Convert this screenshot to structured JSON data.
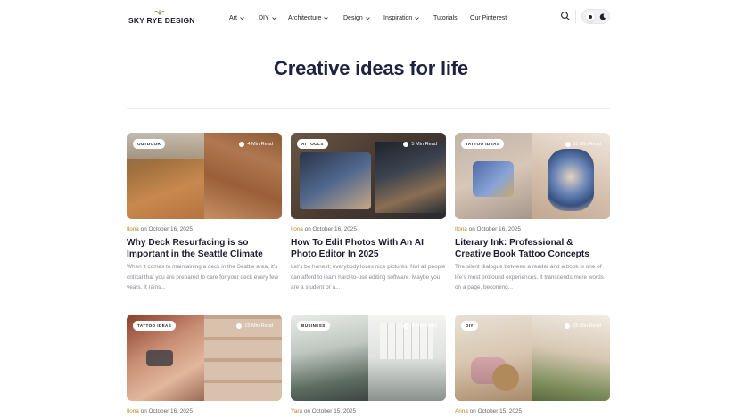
{
  "site": {
    "logo_text": "SKY RYE DESIGN"
  },
  "nav": [
    {
      "label": "Art",
      "has_dropdown": true
    },
    {
      "label": "DIY",
      "has_dropdown": true
    },
    {
      "label": "Architecture",
      "has_dropdown": true
    },
    {
      "label": "Design",
      "has_dropdown": true
    },
    {
      "label": "Inspiration",
      "has_dropdown": true
    },
    {
      "label": "Tutorials",
      "has_dropdown": false
    },
    {
      "label": "Our Pinterest",
      "has_dropdown": false
    }
  ],
  "icons": {
    "search": "search-icon",
    "theme_light": "sun-icon",
    "theme_dark": "moon-icon",
    "read_time": "clock-icon"
  },
  "hero": {
    "title": "Creative ideas for life"
  },
  "colors": {
    "author": "#b08a2e",
    "heading": "#1e2140",
    "excerpt": "#8a8a93"
  },
  "cards": [
    {
      "tag": "OUTDOOR",
      "read_time": "4 Min Read",
      "author": "Ilona",
      "date_prefix": "on",
      "date": "October 16, 2025",
      "title": "Why Deck Resurfacing is so Important in the Seattle Climate",
      "excerpt": "When it comes to maintaining a deck in the Seattle area, it’s critical that you are prepared to care for your deck every few years. It rains..."
    },
    {
      "tag": "AI TOOLS",
      "read_time": "5 Min Read",
      "author": "Ilona",
      "date_prefix": "on",
      "date": "October 16, 2025",
      "title": "How To Edit Photos With An AI Photo Editor In 2025",
      "excerpt": "Let’s be honest; everybody loves nice pictures. Not all people can afford to learn hard-to-use editing software. Maybe you are a student or a..."
    },
    {
      "tag": "TATTOO IDEAS",
      "read_time": "11 Min Read",
      "author": "Ilona",
      "date_prefix": "on",
      "date": "October 16, 2025",
      "title": "Literary Ink: Professional & Creative Book Tattoo Concepts",
      "excerpt": "The silent dialogue between a reader and a book is one of life’s most profound experiences. It transcends mere words on a page, becoming..."
    },
    {
      "tag": "TATTOO IDEAS",
      "read_time": "15 Min Read",
      "author": "Ilona",
      "date_prefix": "on",
      "date": "October 16, 2025"
    },
    {
      "tag": "BUSINESS",
      "read_time": "4 Min Read",
      "author": "Yara",
      "date_prefix": "on",
      "date": "October 15, 2025"
    },
    {
      "tag": "DIY",
      "read_time": "15 Min Read",
      "author": "Arina",
      "date_prefix": "on",
      "date": "October 15, 2025"
    }
  ]
}
